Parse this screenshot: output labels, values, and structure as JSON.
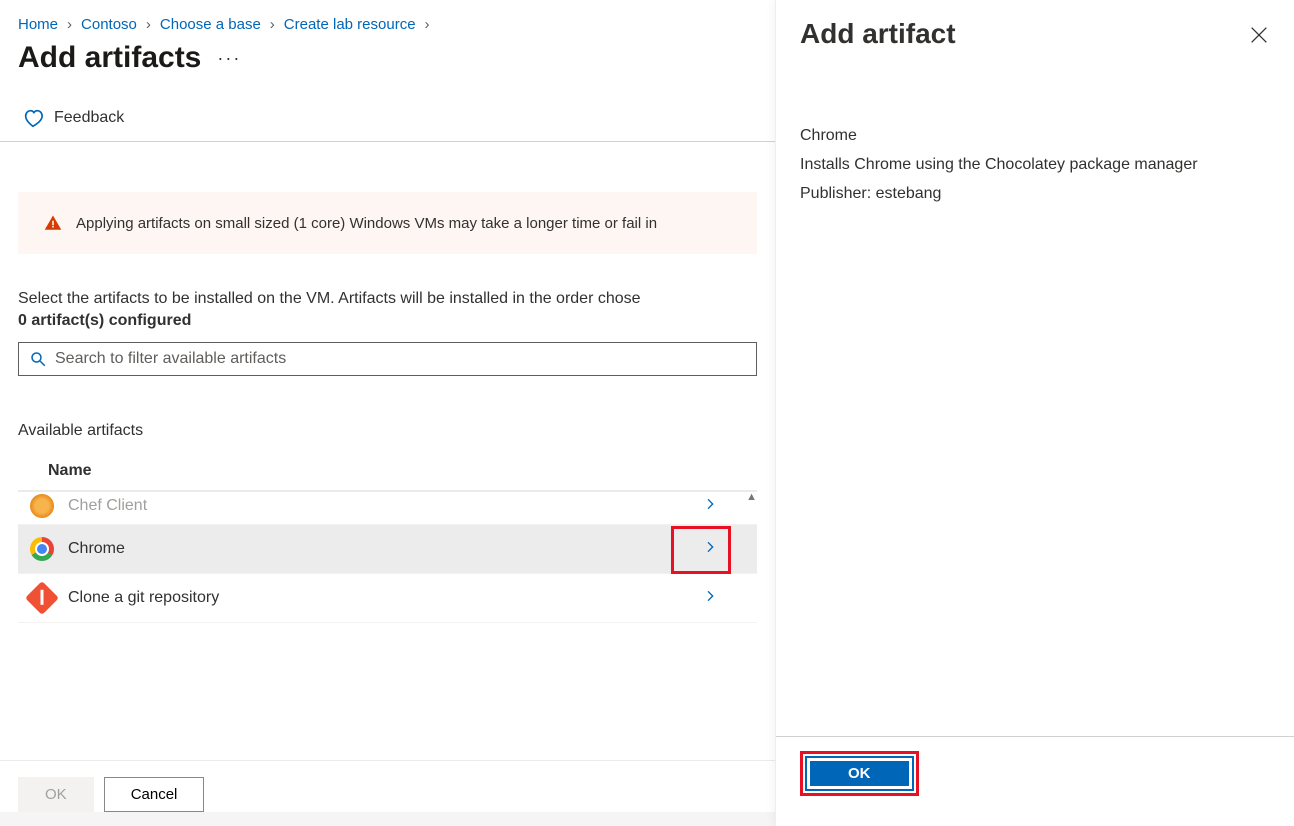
{
  "breadcrumb": {
    "items": [
      {
        "label": "Home"
      },
      {
        "label": "Contoso"
      },
      {
        "label": "Choose a base"
      },
      {
        "label": "Create lab resource"
      }
    ]
  },
  "page": {
    "title": "Add artifacts",
    "feedback_label": "Feedback",
    "warning": "Applying artifacts on small sized (1 core) Windows VMs may take a longer time or fail in",
    "intro": "Select the artifacts to be installed on the VM. Artifacts will be installed in the order chose",
    "configured_count": "0 artifact(s) configured",
    "search_placeholder": "Search to filter available artifacts",
    "available_title": "Available artifacts",
    "name_col": "Name",
    "ok_label": "OK",
    "cancel_label": "Cancel"
  },
  "artifacts": [
    {
      "name": "Chef Client",
      "icon": "chef",
      "selected": false,
      "truncated": true
    },
    {
      "name": "Chrome",
      "icon": "chrome",
      "selected": true,
      "highlighted": true
    },
    {
      "name": "Clone a git repository",
      "icon": "git",
      "selected": false
    }
  ],
  "panel": {
    "title": "Add artifact",
    "name": "Chrome",
    "description": "Installs Chrome using the Chocolatey package manager",
    "publisher_label": "Publisher: estebang",
    "ok_label": "OK"
  }
}
